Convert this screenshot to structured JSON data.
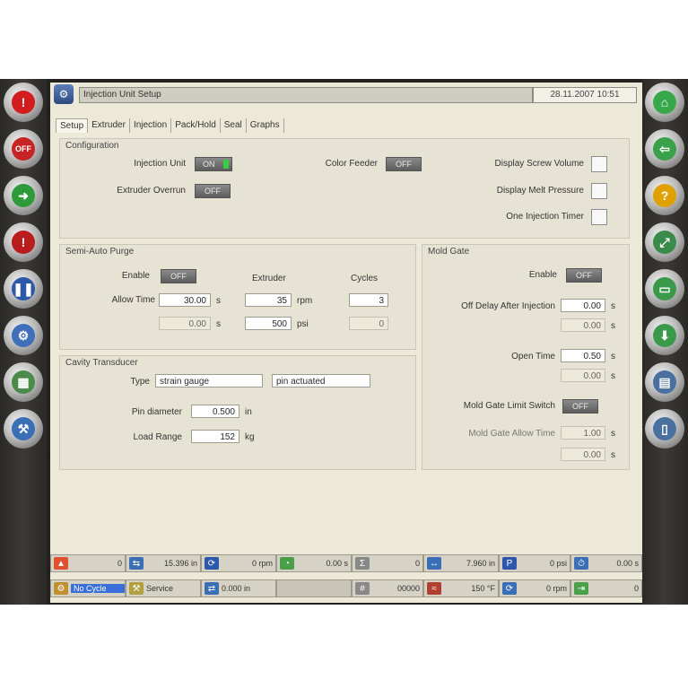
{
  "window": {
    "title": "Injection Unit Setup",
    "datetime": "28.11.2007 10:51"
  },
  "tabs": [
    "Setup",
    "Extruder",
    "Injection",
    "Pack/Hold",
    "Seal",
    "Graphs"
  ],
  "config": {
    "title": "Configuration",
    "injection_unit": "Injection Unit",
    "injection_unit_state": "ON",
    "extruder_overrun": "Extruder Overrun",
    "extruder_overrun_state": "OFF",
    "color_feeder": "Color Feeder",
    "color_feeder_state": "OFF",
    "display_screw_volume": "Display Screw Volume",
    "display_melt_pressure": "Display Melt Pressure",
    "one_injection_timer": "One Injection Timer"
  },
  "purge": {
    "title": "Semi-Auto Purge",
    "enable": "Enable",
    "enable_state": "OFF",
    "extruder": "Extruder",
    "cycles": "Cycles",
    "allow_time": "Allow Time",
    "allow_time_value": "30.00",
    "allow_time_unit": "s",
    "actual_time": "0.00",
    "actual_time_unit": "s",
    "rpm_value": "35",
    "rpm_unit": "rpm",
    "psi_value": "500",
    "psi_unit": "psi",
    "cycles_value": "3",
    "cycles_actual": "0"
  },
  "mold_gate": {
    "title": "Mold Gate",
    "enable": "Enable",
    "enable_state": "OFF",
    "off_delay": "Off Delay After Injection",
    "off_delay_value": "0.00",
    "off_delay_unit": "s",
    "off_delay_actual": "0.00",
    "off_delay_actual_unit": "s",
    "open_time": "Open Time",
    "open_time_value": "0.50",
    "open_time_unit": "s",
    "open_time_actual": "0.00",
    "open_time_actual_unit": "s",
    "limit_switch": "Mold Gate Limit Switch",
    "limit_switch_state": "OFF",
    "allow_time": "Mold Gate Allow Time",
    "allow_time_value": "1.00",
    "allow_time_unit": "s",
    "allow_time_actual": "0.00",
    "allow_time_actual_unit": "s"
  },
  "transducer": {
    "title": "Cavity Transducer",
    "type": "Type",
    "type_value1": "strain gauge",
    "type_value2": "pin actuated",
    "pin_diameter": "Pin diameter",
    "pin_diameter_value": "0.500",
    "pin_diameter_unit": "in",
    "load_range": "Load Range",
    "load_range_value": "152",
    "load_range_unit": "kg"
  },
  "status1": [
    "0",
    "15.396 in",
    "0 rpm",
    "0.00 s",
    "0",
    "7.960 in",
    "0 psi",
    "0.00 s"
  ],
  "status2": [
    "No Cycle",
    "Service",
    "0.000 in",
    "",
    "00000",
    "150 °F",
    "0 rpm",
    "0"
  ],
  "colors": {
    "screen_bg": "#ece9d8",
    "panel_bg": "#e6e3d4",
    "led_on": "#37d23b",
    "frame": "#23211f"
  }
}
